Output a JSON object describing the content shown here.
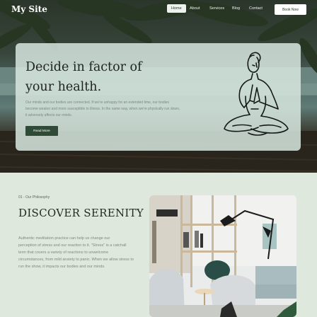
{
  "nav": {
    "logo": "My Site",
    "links": [
      "Home",
      "About",
      "Services",
      "Blog",
      "Contact"
    ],
    "book_button": "Book Now"
  },
  "hero": {
    "headline_line1": "Decide in factor of",
    "headline_line2": "your health.",
    "text_line1": "Our minds and our bodies are connected. If we're unhappy for an extended time, our bodies",
    "text_line2": "become weaker and more susceptible to illness. In the same way, when we're physically run down,",
    "text_line3": "it adversely affects our minds.",
    "button_label": "Read More"
  },
  "philosophy": {
    "eyebrow": "01 - Our Philosophy",
    "title": "DISCOVER SERENITY",
    "text_line1": "Authentic meditation practice can help us change our",
    "text_line2": "perception of stress and our reaction to it. \"Stress\" is a catchall",
    "text_line3": "term that covers a variety of reactions to unwelcome",
    "text_line4": "circumstances, from mild anxiety to panic. When we allow stress to",
    "text_line5": "run the show, it impacts our bodies and our minds."
  },
  "colors": {
    "accent": "#2f4a37",
    "section_bg": "#dfe8dc",
    "card_bg": "#d6e6de"
  },
  "icons": [
    "meditation-figure-icon"
  ]
}
